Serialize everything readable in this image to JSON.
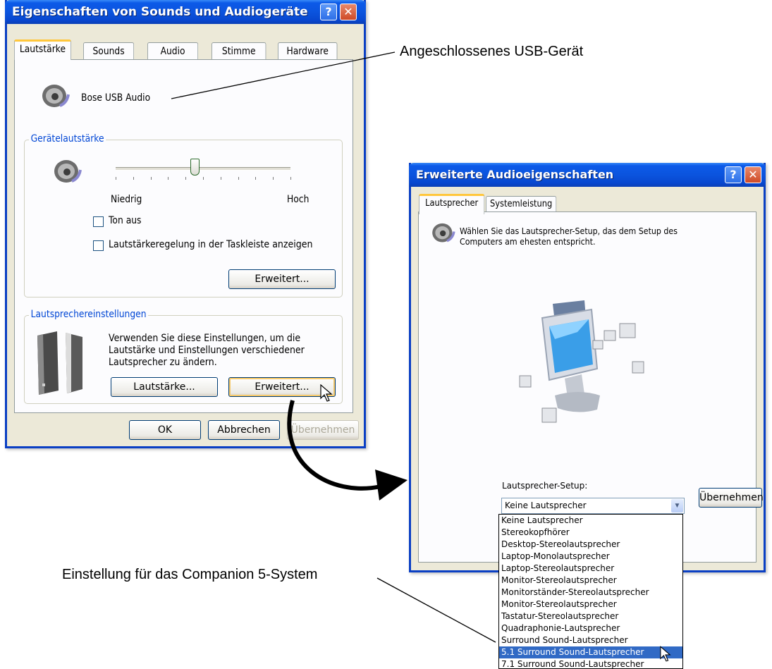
{
  "colors": {
    "titlebar": "#0b54de",
    "selection": "#316ac5",
    "group_label": "#0046d5"
  },
  "main_dialog": {
    "title": "Eigenschaften von Sounds und Audiogeräte",
    "tabs": [
      "Lautstärke",
      "Sounds",
      "Audio",
      "Stimme",
      "Hardware"
    ],
    "device_name": "Bose USB Audio",
    "volume_group_label": "Gerätelautstärke",
    "slider_low": "Niedrig",
    "slider_high": "Hoch",
    "slider_value_fraction": 0.45,
    "mute_label": "Ton aus",
    "taskbar_label": "Lautstärkeregelung in der Taskleiste anzeigen",
    "advanced_button": "Erweitert...",
    "speaker_group_label": "Lautsprechereinstellungen",
    "speaker_text_1": "Verwenden Sie diese Einstellungen, um die",
    "speaker_text_2": "Lautstärke und Einstellungen verschiedener",
    "speaker_text_3": "Lautsprecher zu ändern.",
    "speaker_volume_button": "Lautstärke...",
    "speaker_advanced_button": "Erweitert...",
    "ok": "OK",
    "cancel": "Abbrechen",
    "apply": "Übernehmen"
  },
  "adv_dialog": {
    "title": "Erweiterte Audioeigenschaften",
    "tabs": [
      "Lautsprecher",
      "Systemleistung"
    ],
    "desc_1": "Wählen Sie das Lautsprecher-Setup, das dem Setup des",
    "desc_2": "Computers am ehesten entspricht.",
    "setup_label": "Lautsprecher-Setup:",
    "selected_option": "Keine Lautsprecher",
    "apply": "Übernehmen",
    "options": [
      "Keine Lautsprecher",
      "Stereokopfhörer",
      "Desktop-Stereolautsprecher",
      "Laptop-Monolautsprecher",
      "Laptop-Stereolautsprecher",
      "Monitor-Stereolautsprecher",
      "Monitorständer-Stereolautsprecher",
      "Monitor-Stereolautsprecher",
      "Tastatur-Stereolautsprecher",
      "Quadraphonie-Lautsprecher",
      "Surround Sound-Lautsprecher",
      "5.1 Surround Sound-Lautsprecher",
      "7.1 Surround Sound-Lautsprecher"
    ],
    "highlighted_index": 11
  },
  "annotations": {
    "usb_device": "Angeschlossenes USB-Gerät",
    "companion": "Einstellung für das Companion 5-System"
  }
}
